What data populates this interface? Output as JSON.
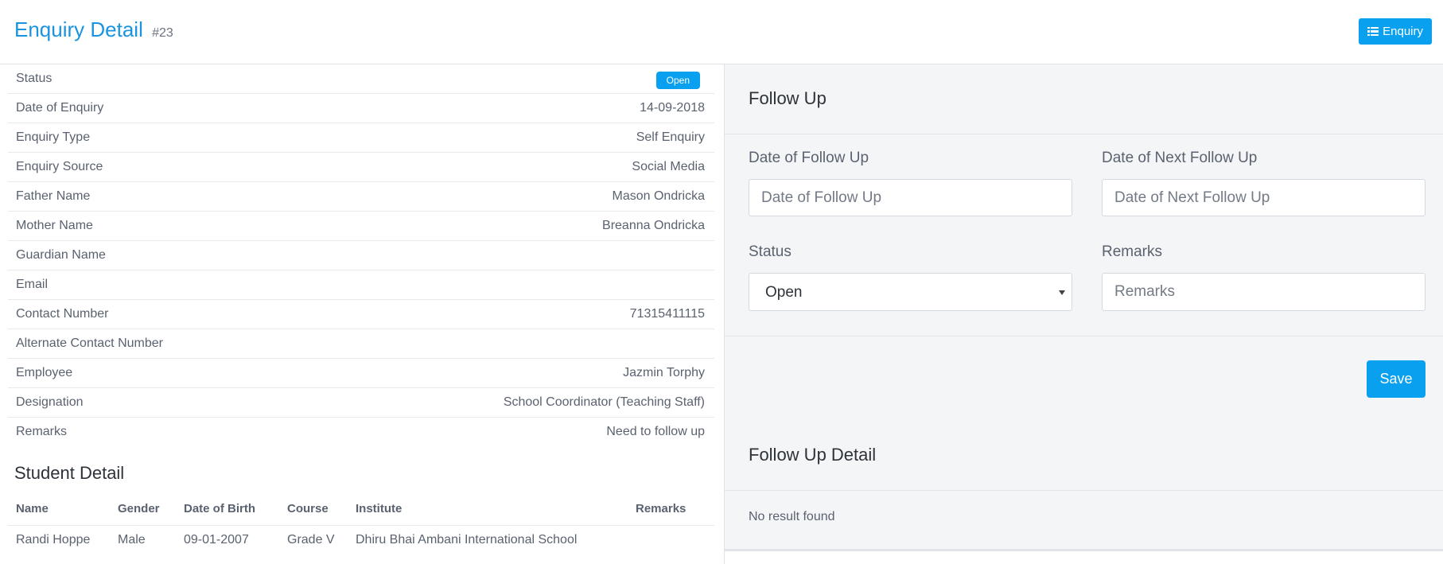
{
  "header": {
    "title": "Enquiry Detail",
    "id_label": "#23",
    "enquiry_button": "Enquiry"
  },
  "enquiry": {
    "status_label": "Status",
    "status_value": "Open",
    "rows": [
      {
        "label": "Date of Enquiry",
        "value": "14-09-2018"
      },
      {
        "label": "Enquiry Type",
        "value": "Self Enquiry"
      },
      {
        "label": "Enquiry Source",
        "value": "Social Media"
      },
      {
        "label": "Father Name",
        "value": "Mason Ondricka"
      },
      {
        "label": "Mother Name",
        "value": "Breanna Ondricka"
      },
      {
        "label": "Guardian Name",
        "value": ""
      },
      {
        "label": "Email",
        "value": ""
      },
      {
        "label": "Contact Number",
        "value": "71315411115"
      },
      {
        "label": "Alternate Contact Number",
        "value": ""
      },
      {
        "label": "Employee",
        "value": "Jazmin Torphy"
      },
      {
        "label": "Designation",
        "value": "School Coordinator (Teaching Staff)"
      },
      {
        "label": "Remarks",
        "value": "Need to follow up"
      }
    ]
  },
  "student_detail": {
    "title": "Student Detail",
    "columns": [
      "Name",
      "Gender",
      "Date of Birth",
      "Course",
      "Institute",
      "Remarks"
    ],
    "rows": [
      [
        "Randi Hoppe",
        "Male",
        "09-01-2007",
        "Grade V",
        "Dhiru Bhai Ambani International School",
        ""
      ]
    ]
  },
  "follow_up": {
    "title": "Follow Up",
    "date_label": "Date of Follow Up",
    "date_placeholder": "Date of Follow Up",
    "next_date_label": "Date of Next Follow Up",
    "next_date_placeholder": "Date of Next Follow Up",
    "status_label": "Status",
    "status_value": "Open",
    "remarks_label": "Remarks",
    "remarks_placeholder": "Remarks",
    "save_button": "Save"
  },
  "follow_up_detail": {
    "title": "Follow Up Detail",
    "empty_text": "No result found"
  },
  "colors": {
    "accent": "#0aa0f0",
    "title": "#1b93df",
    "panel_bg": "#f4f5f7"
  }
}
